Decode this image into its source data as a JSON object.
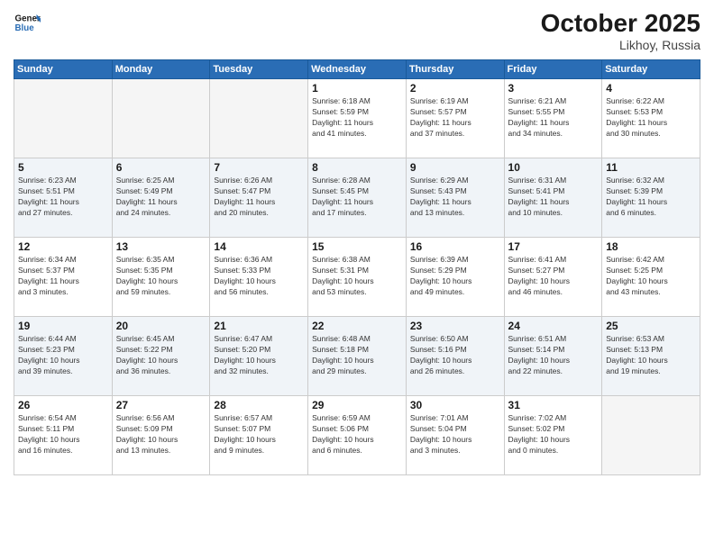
{
  "header": {
    "logo_line1": "General",
    "logo_line2": "Blue",
    "month": "October 2025",
    "location": "Likhoy, Russia"
  },
  "weekdays": [
    "Sunday",
    "Monday",
    "Tuesday",
    "Wednesday",
    "Thursday",
    "Friday",
    "Saturday"
  ],
  "weeks": [
    [
      {
        "day": "",
        "info": ""
      },
      {
        "day": "",
        "info": ""
      },
      {
        "day": "",
        "info": ""
      },
      {
        "day": "1",
        "info": "Sunrise: 6:18 AM\nSunset: 5:59 PM\nDaylight: 11 hours\nand 41 minutes."
      },
      {
        "day": "2",
        "info": "Sunrise: 6:19 AM\nSunset: 5:57 PM\nDaylight: 11 hours\nand 37 minutes."
      },
      {
        "day": "3",
        "info": "Sunrise: 6:21 AM\nSunset: 5:55 PM\nDaylight: 11 hours\nand 34 minutes."
      },
      {
        "day": "4",
        "info": "Sunrise: 6:22 AM\nSunset: 5:53 PM\nDaylight: 11 hours\nand 30 minutes."
      }
    ],
    [
      {
        "day": "5",
        "info": "Sunrise: 6:23 AM\nSunset: 5:51 PM\nDaylight: 11 hours\nand 27 minutes."
      },
      {
        "day": "6",
        "info": "Sunrise: 6:25 AM\nSunset: 5:49 PM\nDaylight: 11 hours\nand 24 minutes."
      },
      {
        "day": "7",
        "info": "Sunrise: 6:26 AM\nSunset: 5:47 PM\nDaylight: 11 hours\nand 20 minutes."
      },
      {
        "day": "8",
        "info": "Sunrise: 6:28 AM\nSunset: 5:45 PM\nDaylight: 11 hours\nand 17 minutes."
      },
      {
        "day": "9",
        "info": "Sunrise: 6:29 AM\nSunset: 5:43 PM\nDaylight: 11 hours\nand 13 minutes."
      },
      {
        "day": "10",
        "info": "Sunrise: 6:31 AM\nSunset: 5:41 PM\nDaylight: 11 hours\nand 10 minutes."
      },
      {
        "day": "11",
        "info": "Sunrise: 6:32 AM\nSunset: 5:39 PM\nDaylight: 11 hours\nand 6 minutes."
      }
    ],
    [
      {
        "day": "12",
        "info": "Sunrise: 6:34 AM\nSunset: 5:37 PM\nDaylight: 11 hours\nand 3 minutes."
      },
      {
        "day": "13",
        "info": "Sunrise: 6:35 AM\nSunset: 5:35 PM\nDaylight: 10 hours\nand 59 minutes."
      },
      {
        "day": "14",
        "info": "Sunrise: 6:36 AM\nSunset: 5:33 PM\nDaylight: 10 hours\nand 56 minutes."
      },
      {
        "day": "15",
        "info": "Sunrise: 6:38 AM\nSunset: 5:31 PM\nDaylight: 10 hours\nand 53 minutes."
      },
      {
        "day": "16",
        "info": "Sunrise: 6:39 AM\nSunset: 5:29 PM\nDaylight: 10 hours\nand 49 minutes."
      },
      {
        "day": "17",
        "info": "Sunrise: 6:41 AM\nSunset: 5:27 PM\nDaylight: 10 hours\nand 46 minutes."
      },
      {
        "day": "18",
        "info": "Sunrise: 6:42 AM\nSunset: 5:25 PM\nDaylight: 10 hours\nand 43 minutes."
      }
    ],
    [
      {
        "day": "19",
        "info": "Sunrise: 6:44 AM\nSunset: 5:23 PM\nDaylight: 10 hours\nand 39 minutes."
      },
      {
        "day": "20",
        "info": "Sunrise: 6:45 AM\nSunset: 5:22 PM\nDaylight: 10 hours\nand 36 minutes."
      },
      {
        "day": "21",
        "info": "Sunrise: 6:47 AM\nSunset: 5:20 PM\nDaylight: 10 hours\nand 32 minutes."
      },
      {
        "day": "22",
        "info": "Sunrise: 6:48 AM\nSunset: 5:18 PM\nDaylight: 10 hours\nand 29 minutes."
      },
      {
        "day": "23",
        "info": "Sunrise: 6:50 AM\nSunset: 5:16 PM\nDaylight: 10 hours\nand 26 minutes."
      },
      {
        "day": "24",
        "info": "Sunrise: 6:51 AM\nSunset: 5:14 PM\nDaylight: 10 hours\nand 22 minutes."
      },
      {
        "day": "25",
        "info": "Sunrise: 6:53 AM\nSunset: 5:13 PM\nDaylight: 10 hours\nand 19 minutes."
      }
    ],
    [
      {
        "day": "26",
        "info": "Sunrise: 6:54 AM\nSunset: 5:11 PM\nDaylight: 10 hours\nand 16 minutes."
      },
      {
        "day": "27",
        "info": "Sunrise: 6:56 AM\nSunset: 5:09 PM\nDaylight: 10 hours\nand 13 minutes."
      },
      {
        "day": "28",
        "info": "Sunrise: 6:57 AM\nSunset: 5:07 PM\nDaylight: 10 hours\nand 9 minutes."
      },
      {
        "day": "29",
        "info": "Sunrise: 6:59 AM\nSunset: 5:06 PM\nDaylight: 10 hours\nand 6 minutes."
      },
      {
        "day": "30",
        "info": "Sunrise: 7:01 AM\nSunset: 5:04 PM\nDaylight: 10 hours\nand 3 minutes."
      },
      {
        "day": "31",
        "info": "Sunrise: 7:02 AM\nSunset: 5:02 PM\nDaylight: 10 hours\nand 0 minutes."
      },
      {
        "day": "",
        "info": ""
      }
    ]
  ]
}
